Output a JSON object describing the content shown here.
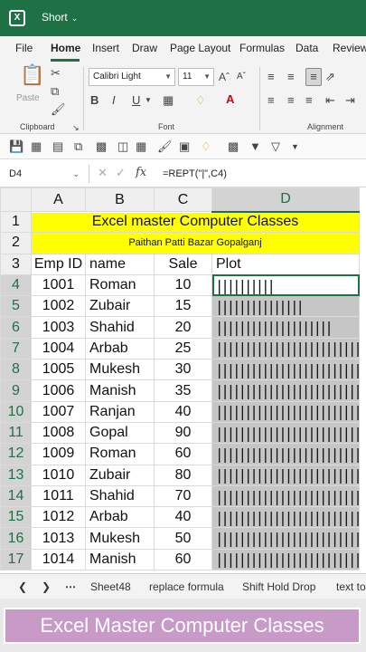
{
  "app": {
    "file_name": "Short"
  },
  "ribbon_tabs": [
    "File",
    "Home",
    "Insert",
    "Draw",
    "Page Layout",
    "Formulas",
    "Data",
    "Review"
  ],
  "ribbon": {
    "paste_label": "Paste",
    "clipboard_label": "Clipboard",
    "font_label": "Font",
    "alignment_label": "Alignment",
    "font_name": "Calibri Light",
    "font_size": "11",
    "bold": "B",
    "italic": "I",
    "underline": "U"
  },
  "formula_bar": {
    "cell_ref": "D4",
    "fx": "fx",
    "formula": "=REPT(\"|\",C4)"
  },
  "columns": [
    "A",
    "B",
    "C",
    "D"
  ],
  "title_rows": {
    "title": "Excel master Computer Classes",
    "subtitle": "Paithan Patti Bazar Gopalganj"
  },
  "headers": [
    "Emp ID",
    "name",
    "Sale",
    "Plot"
  ],
  "rows": [
    {
      "n": "4",
      "id": "1001",
      "name": "Roman",
      "sale": "10",
      "plot": "||||||||||"
    },
    {
      "n": "5",
      "id": "1002",
      "name": "Zubair",
      "sale": "15",
      "plot": "|||||||||||||||"
    },
    {
      "n": "6",
      "id": "1003",
      "name": "Shahid",
      "sale": "20",
      "plot": "||||||||||||||||||||"
    },
    {
      "n": "7",
      "id": "1004",
      "name": "Arbab",
      "sale": "25",
      "plot": "|||||||||||||||||||||||||"
    },
    {
      "n": "8",
      "id": "1005",
      "name": "Mukesh",
      "sale": "30",
      "plot": "||||||||||||||||||||||||||||||"
    },
    {
      "n": "9",
      "id": "1006",
      "name": "Manish",
      "sale": "35",
      "plot": "|||||||||||||||||||||||||||||||||||"
    },
    {
      "n": "10",
      "id": "1007",
      "name": "Ranjan",
      "sale": "40",
      "plot": "||||||||||||||||||||||||||||||||||||||||"
    },
    {
      "n": "11",
      "id": "1008",
      "name": "Gopal",
      "sale": "90",
      "plot": "||||||||||||||||||||||||||||||||||||||||||||||||"
    },
    {
      "n": "12",
      "id": "1009",
      "name": "Roman",
      "sale": "60",
      "plot": "||||||||||||||||||||||||||||||||||||||||||||||||"
    },
    {
      "n": "13",
      "id": "1010",
      "name": "Zubair",
      "sale": "80",
      "plot": "||||||||||||||||||||||||||||||||||||||||||||||||"
    },
    {
      "n": "14",
      "id": "1011",
      "name": "Shahid",
      "sale": "70",
      "plot": "||||||||||||||||||||||||||||||||||||||||||||||||"
    },
    {
      "n": "15",
      "id": "1012",
      "name": "Arbab",
      "sale": "40",
      "plot": "||||||||||||||||||||||||||||||||||||||||"
    },
    {
      "n": "16",
      "id": "1013",
      "name": "Mukesh",
      "sale": "50",
      "plot": "||||||||||||||||||||||||||||||||||||||||||||||||"
    },
    {
      "n": "17",
      "id": "1014",
      "name": "Manish",
      "sale": "60",
      "plot": "||||||||||||||||||||||||||||||||||||||||||||||||"
    }
  ],
  "sheet_tabs": [
    "Sheet48",
    "replace formula",
    "Shift Hold Drop",
    "text to"
  ],
  "banner": "Excel Master Computer Classes",
  "colors": {
    "excel_green": "#1e7145",
    "title_fill": "#ffff00",
    "banner": "#c79ac8"
  }
}
